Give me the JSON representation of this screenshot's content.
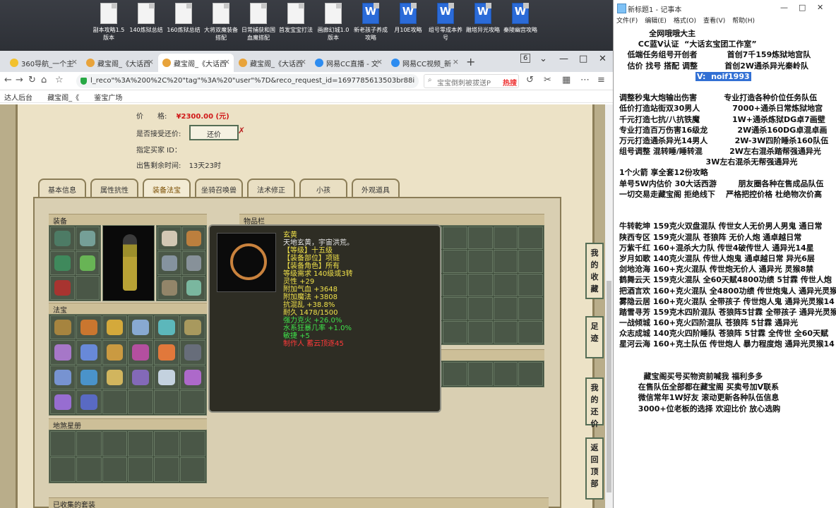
{
  "desktop": {
    "icons": [
      {
        "label": "副本攻略1.5版本",
        "type": "doc"
      },
      {
        "label": "140炼狱总结",
        "type": "doc"
      },
      {
        "label": "160炼狱总结",
        "type": "doc"
      },
      {
        "label": "大将双魔装备搭配",
        "type": "doc"
      },
      {
        "label": "日常捕获和国血魔搭配",
        "type": "doc"
      },
      {
        "label": "首发宝宝打法",
        "type": "doc"
      },
      {
        "label": "画廊幻城1.0版本",
        "type": "doc"
      },
      {
        "label": "新老孩子养成攻略",
        "type": "word"
      },
      {
        "label": "月10E攻略",
        "type": "word"
      },
      {
        "label": "组号零成本养号",
        "type": "word"
      },
      {
        "label": "雕塔异光攻略",
        "type": "word"
      },
      {
        "label": "秦陵幽宫攻略",
        "type": "word"
      }
    ]
  },
  "browser": {
    "tabs": [
      {
        "label": "360导航_一个主",
        "icon": "yellow"
      },
      {
        "label": "藏宝阁_《大话西",
        "icon": "orange"
      },
      {
        "label": "藏宝阁_《大话西",
        "icon": "orange",
        "active": true
      },
      {
        "label": "藏宝阁_《大话西",
        "icon": "orange"
      },
      {
        "label": "网易CC直播 - 文",
        "icon": "blue"
      },
      {
        "label": "网易CC视频_新",
        "icon": "blue"
      }
    ],
    "tab_count": "6",
    "url": "l_reco\"%3A%200%2C%20\"tag\"%3A%20\"user\"%7D&reco_request_id=1697785613503br88i",
    "search_placeholder": "宝宝倒刺被拔送P",
    "search_hot": "热搜",
    "bookmarks": [
      "达人后台",
      "藏宝阁_《",
      "鉴宝广场"
    ]
  },
  "listing": {
    "price_label": "价　　格:",
    "price": "¥2300.00 (元)",
    "counter_label": "是否接受还价:",
    "counter_button": "还价",
    "buyer_label": "指定买家 ID：",
    "remaining_label": "出售剩余时间:",
    "remaining": "13天23时"
  },
  "page_tabs": [
    "基本信息",
    "属性抗性",
    "装备法宝",
    "坐骑召唤兽",
    "法术修正",
    "小孩",
    "外观道具"
  ],
  "active_tab": "装备法宝",
  "sections": {
    "equip": "装备",
    "fabao": "法宝",
    "bag": "物品栏",
    "storage": "仓库(已锁)",
    "earth": "地煞星册",
    "sets": "已收集的套装"
  },
  "tooltip": {
    "name": "玄黄",
    "lines": [
      {
        "text": "天地玄黄，宇宙洪荒。",
        "color": "w"
      },
      {
        "text": "【等级】十五级",
        "color": "y"
      },
      {
        "text": "【装备部位】项链",
        "color": "y"
      },
      {
        "text": "【装备角色】所有",
        "color": "y"
      },
      {
        "text": "等级需求 140级或3转",
        "color": "y"
      },
      {
        "text": "灵性 +29",
        "color": "y"
      },
      {
        "text": "附加气血 +3648",
        "color": "y"
      },
      {
        "text": "附加魔法 +3808",
        "color": "y"
      },
      {
        "text": "抗混乱 +38.8%",
        "color": "y"
      },
      {
        "text": "耐久 1478/1500",
        "color": "y"
      },
      {
        "text": "强力克火 +26.0%",
        "color": "g"
      },
      {
        "text": "水系狂暴几率 +1.0%",
        "color": "g"
      },
      {
        "text": "敏捷 +5",
        "color": "g"
      },
      {
        "text": "制作人 蓄云顶逐45",
        "color": "r"
      }
    ]
  },
  "side_buttons": [
    "我的收藏",
    "足迹",
    "我的还价",
    "返回顶部"
  ],
  "notepad": {
    "title": "新标题1 - 记事本",
    "menu": [
      "文件(F)",
      "编辑(E)",
      "格式(O)",
      "查看(V)",
      "帮助(H)"
    ],
    "lines": [
      "           全网哦哦大主",
      "       CC蓝V认证  “大话玄宝团工作室”",
      "   低端任务组号开创者           首创7千159炼狱地宫队",
      "   估价 找号 搭配 调整          首创2W通杀异光秦岭队",
      "",
      "",
      "调整秒鬼大炮输出伤害          专业打造各种价位任务队伍",
      "低价打造站街双30男人            7000+通杀日常炼狱地宫",
      "千元打造七抗/八抗铁魔            1W+通杀炼狱DG卓7画壁",
      "专业打造百万伤害16级龙           2W通杀160DG卓混卓画",
      "万元打造通杀异光14男人          2W-3W四阶睡杀160队伍",
      "组号调整 混转睡/睡转混          2W左右混杀踏帮强通异光",
      "                                3W左右混杀无帮强通异光",
      "1个火箭 享全套12份攻略",
      "单号5W内估价 30大话西游        朋友圈各种在售成品队伍",
      "一切交易走藏宝阁 拒绝线下    严格把控价格 杜绝物次价高",
      "",
      "",
      "牛转乾坤 159克火双盘混队 传世女人无价男人男鬼 通日常",
      "陕西专区 159克火混队 苍狼阵 无价人炮 通卓越日常",
      "万紫千红 160+混杀大力队 传世4破传世人 通异光14星",
      "岁月如歌 140克火混队 传世人炮鬼 通卓越日常 异光6层",
      "剑地沧海 160+克火混队 传世炮无价人 通异光 灵猴8禁",
      "鹤舞云天 159克火混队 全60天赋4800功绩 5甘霖 传世人炮",
      "把酒言欢 160+克火混队 全4800功绩 传世炮鬼人 通异光灵猴",
      "雾隐云居 160+克火混队 全带孩子 传世炮人鬼 通异光灵猴14",
      "踏雪寻芳 159克木四阶混队 苍狼阵5甘霖 全带孩子 通异光灵猴",
      "一战倾城 160+克火四阶混队 苍狼阵 5甘霖 通异光",
      "众志成城 140克火四阶睡队 苍狼阵 5甘霖 全传世 全60天赋",
      "星河云海 160+克土队伍 传世炮人 暴力程度炮 通异光灵猴14",
      "",
      "",
      "         藏宝阁买号买物资前喊我 福利多多",
      "       在售队伍全部都在藏宝阁 买卖号加V联系",
      "       微信常年1W好友 滚动更新各种队伍信息",
      "       3000+位老板的选择 欢迎比价 放心选购"
    ],
    "selected_line": "V:  noif1993"
  },
  "colors": {
    "price": "#d01818",
    "grid_bg": "#3b4838",
    "tooltip_bg": "#2e2d24"
  }
}
